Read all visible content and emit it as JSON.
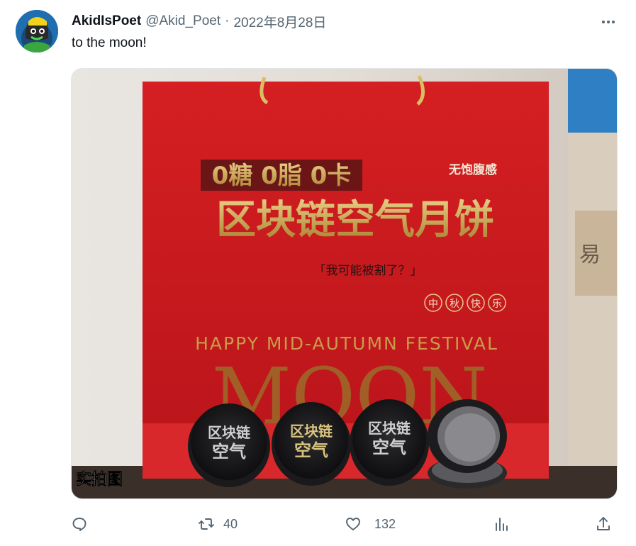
{
  "tweet": {
    "author_name": "AkidIsPoet",
    "author_handle": "@Akid_Poet",
    "separator": "·",
    "date": "2022年8月28日",
    "text": "to the moon!",
    "avatar_icon": "avatar-punk-icon",
    "more_icon": "more-dots-icon"
  },
  "media": {
    "bag_claim": "0糖 0脂 0卡",
    "bag_title": "区块链空气月饼",
    "bag_tag": "无饱腹感",
    "bag_quote": "「我可能被割了？」",
    "bag_festival_chars": [
      "中",
      "秋",
      "快",
      "乐"
    ],
    "bag_english": "HAPPY MID-AUTUMN FESTIVAL",
    "bag_big_word": "MOON",
    "tin_top_line": "区块链",
    "tin_bottom_line": "空气",
    "corner_label": "实拍图"
  },
  "actions": {
    "reply": {
      "icon": "reply-icon",
      "count": ""
    },
    "retweet": {
      "icon": "retweet-icon",
      "count": "40"
    },
    "like": {
      "icon": "heart-icon",
      "count": "132"
    },
    "views": {
      "icon": "views-icon",
      "count": ""
    },
    "share": {
      "icon": "share-icon",
      "count": ""
    }
  },
  "colors": {
    "text_primary": "#0f1419",
    "text_secondary": "#536471",
    "bag_red": "#c8181b",
    "gold": "#c9a24a"
  }
}
